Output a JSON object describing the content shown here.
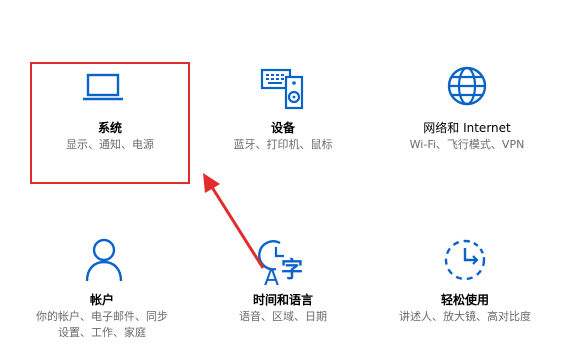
{
  "colors": {
    "accent": "#0a63c9",
    "highlight": "#e22b2b",
    "muted": "#6b6b6b"
  },
  "tiles": [
    {
      "icon": "laptop-icon",
      "title": "系统",
      "desc": [
        "显示、通知、电源"
      ],
      "highlighted": true
    },
    {
      "icon": "devices-icon",
      "title": "设备",
      "desc": [
        "蓝牙、打印机、鼠标"
      ]
    },
    {
      "icon": "globe-icon",
      "title": "网络和 Internet",
      "desc": [
        "Wi-Fi、飞行模式、VPN"
      ]
    },
    {
      "icon": "person-icon",
      "title": "帐户",
      "desc": [
        "你的帐户、电子邮件、同步",
        "设置、工作、家庭"
      ]
    },
    {
      "icon": "time-language-icon",
      "title": "时间和语言",
      "desc": [
        "语音、区域、日期"
      ],
      "glyph": "字"
    },
    {
      "icon": "ease-of-access-icon",
      "title": "轻松使用",
      "desc": [
        "讲述人、放大镜、高对比度"
      ]
    }
  ]
}
